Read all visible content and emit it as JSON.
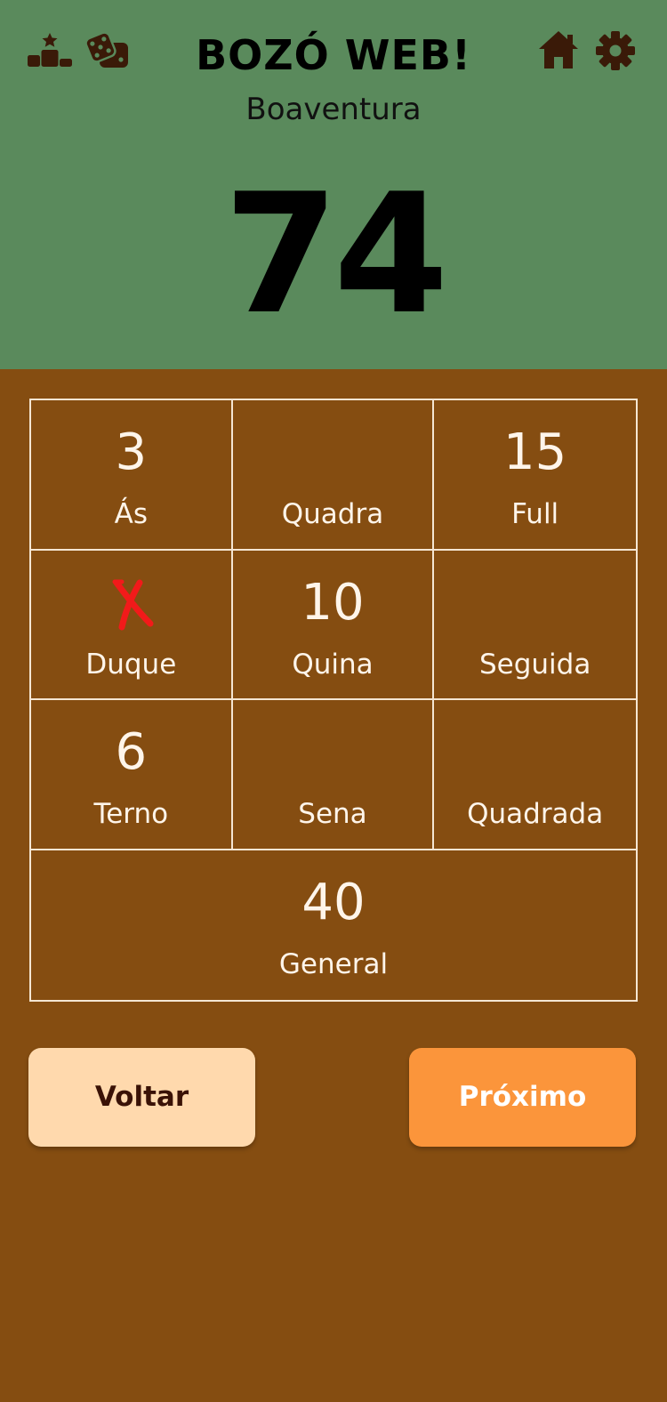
{
  "header": {
    "title": "BOZÓ WEB!",
    "player_name": "Boaventura",
    "score": "74",
    "background_color": "#5A8A5C",
    "icons": [
      "ranking-icon",
      "dice-icon",
      "home-icon",
      "gear-icon"
    ],
    "icon_color": "#3A1A08"
  },
  "scoreboard": {
    "background_color": "#854D11",
    "cells": [
      {
        "label": "Ás",
        "value": "3"
      },
      {
        "label": "Quadra",
        "value": ""
      },
      {
        "label": "Full",
        "value": "15"
      },
      {
        "label": "Duque",
        "value": "",
        "scratched": true,
        "mark_icon": "x-mark-icon",
        "mark_color": "#F21A1A"
      },
      {
        "label": "Quina",
        "value": "10"
      },
      {
        "label": "Seguida",
        "value": ""
      },
      {
        "label": "Terno",
        "value": "6"
      },
      {
        "label": "Sena",
        "value": ""
      },
      {
        "label": "Quadrada",
        "value": ""
      },
      {
        "label": "General",
        "value": "40"
      }
    ]
  },
  "actions": {
    "back_label": "Voltar",
    "next_label": "Próximo",
    "back_color": "#FFD9AD",
    "next_color": "#FB953B"
  }
}
